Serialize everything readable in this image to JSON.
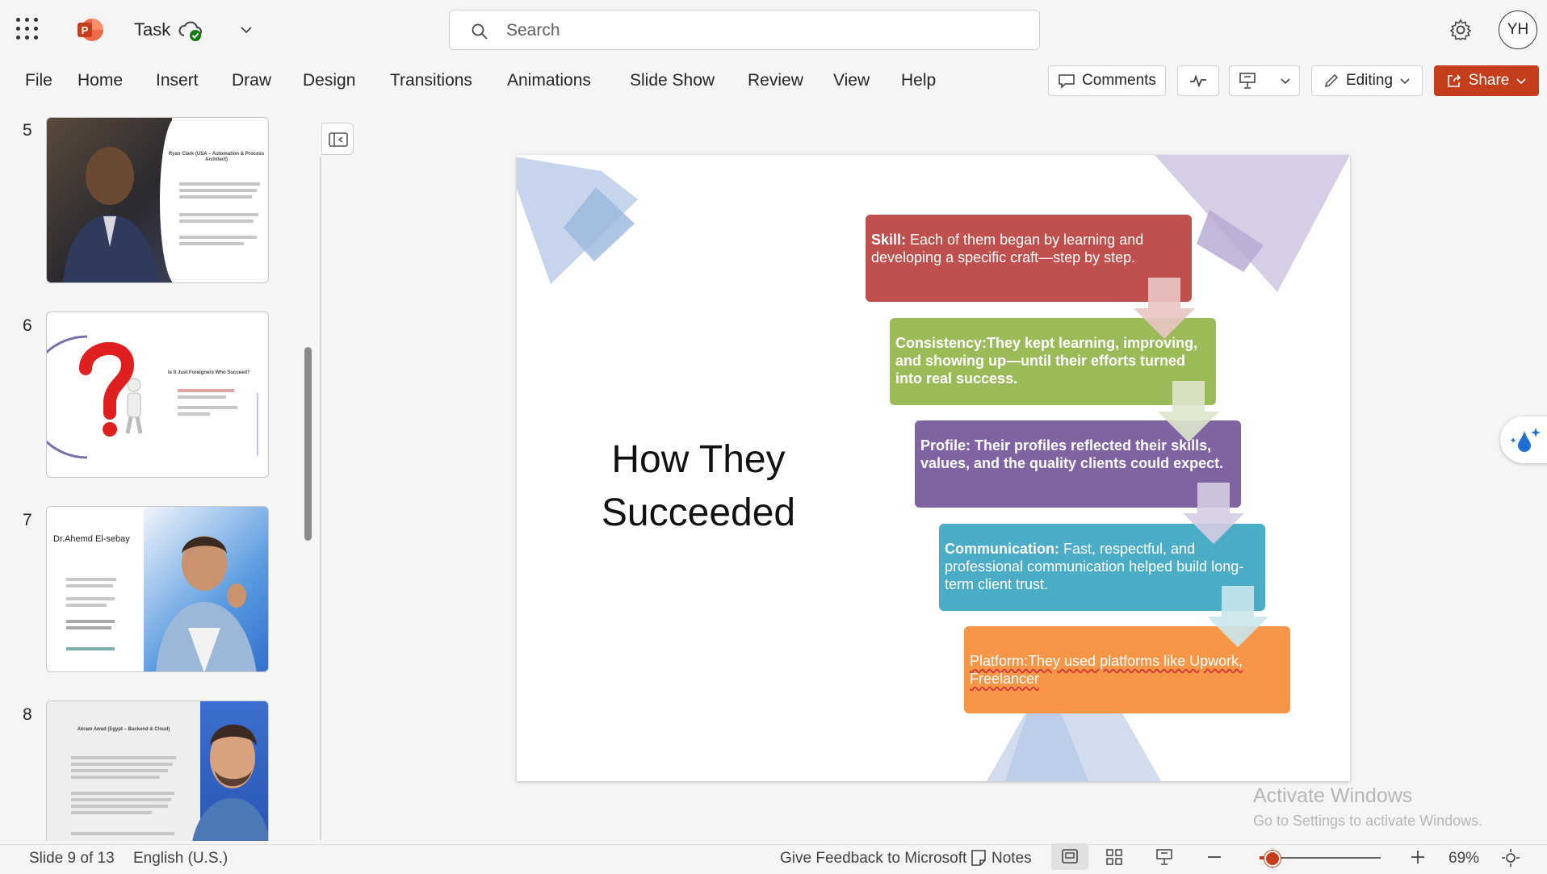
{
  "app": {
    "doc_title": "Task",
    "search_placeholder": "Search",
    "avatar_initials": "YH"
  },
  "menu": [
    "File",
    "Home",
    "Insert",
    "Draw",
    "Design",
    "Transitions",
    "Animations",
    "Slide Show",
    "Review",
    "View",
    "Help"
  ],
  "toolbar": {
    "comments_label": "Comments",
    "editing_label": "Editing",
    "share_label": "Share"
  },
  "thumbnails": [
    {
      "number": "5",
      "title": "Ryan Clark (USA – Automation & Process Architect)"
    },
    {
      "number": "6",
      "title": "Is It Just Foreigners Who Succeed?"
    },
    {
      "number": "7",
      "title": "Dr.Ahemd El-sebay"
    },
    {
      "number": "8",
      "title": "Akram Awad (Egypt – Backend & Cloud)"
    }
  ],
  "slide": {
    "title": "How They Succeeded",
    "steps": [
      {
        "lead": "Skill:",
        "text": " Each of them began by learning and developing a specific craft—step by step.",
        "color": "#c0504d"
      },
      {
        "lead": "Consistency:They kept learning, improving, and showing up—until their efforts turned into real success.",
        "text": "",
        "color": "#9bbb59"
      },
      {
        "lead": "Profile: Their profiles reflected their skills, values, and the quality clients could expect.",
        "text": "",
        "color": "#8064a2"
      },
      {
        "lead": "Communication:",
        "text": " Fast, respectful, and professional communication helped build long-term client trust.",
        "color": "#4bacc6"
      },
      {
        "lead": "",
        "text": "Platform:They used platforms like Upwork, Freelancer",
        "color": "#f79646"
      }
    ]
  },
  "watermark": {
    "line1": "Activate Windows",
    "line2": "Go to Settings to activate Windows."
  },
  "status": {
    "slide_info": "Slide 9 of 13",
    "language": "English (U.S.)",
    "feedback": "Give Feedback to Microsoft",
    "notes": "Notes",
    "zoom": "69%"
  },
  "colors": {
    "accent": "#c43e1c",
    "background": "#f5f5f5"
  }
}
